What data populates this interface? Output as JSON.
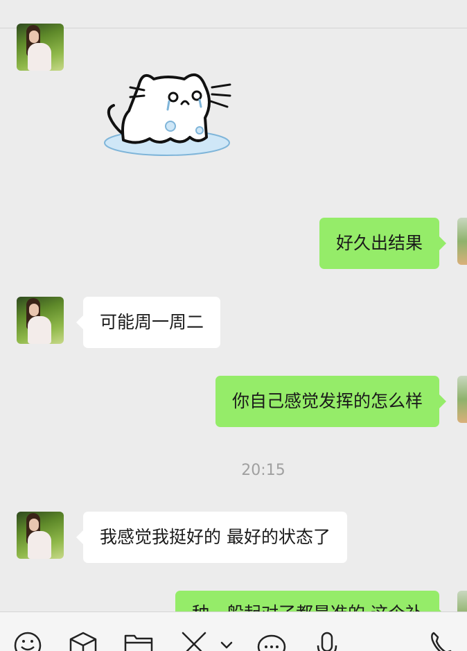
{
  "messages": [
    {
      "side": "in",
      "type": "sticker",
      "sticker": "crying-cat-sticker"
    },
    {
      "side": "out",
      "type": "text",
      "text": "好久出结果"
    },
    {
      "side": "in",
      "type": "text",
      "text": "可能周一周二"
    },
    {
      "side": "out",
      "type": "text",
      "text": "你自己感觉发挥的怎么样"
    },
    {
      "type": "time",
      "text": "20:15"
    },
    {
      "side": "in",
      "type": "text",
      "text": "我感觉我挺好的 最好的状态了"
    },
    {
      "side": "out",
      "type": "text",
      "text": "种一般起对了都是准的 这个补"
    }
  ],
  "toolbar": {
    "icons": [
      "emoji-icon",
      "box-icon",
      "folder-icon",
      "scissors-icon",
      "chevron-down-icon",
      "chat-bubble-icon",
      "microphone-icon",
      "phone-icon"
    ]
  },
  "colors": {
    "background": "#ececec",
    "incoming_bubble": "#ffffff",
    "outgoing_bubble": "#95ec69",
    "timestamp_text": "#a0a0a0"
  }
}
